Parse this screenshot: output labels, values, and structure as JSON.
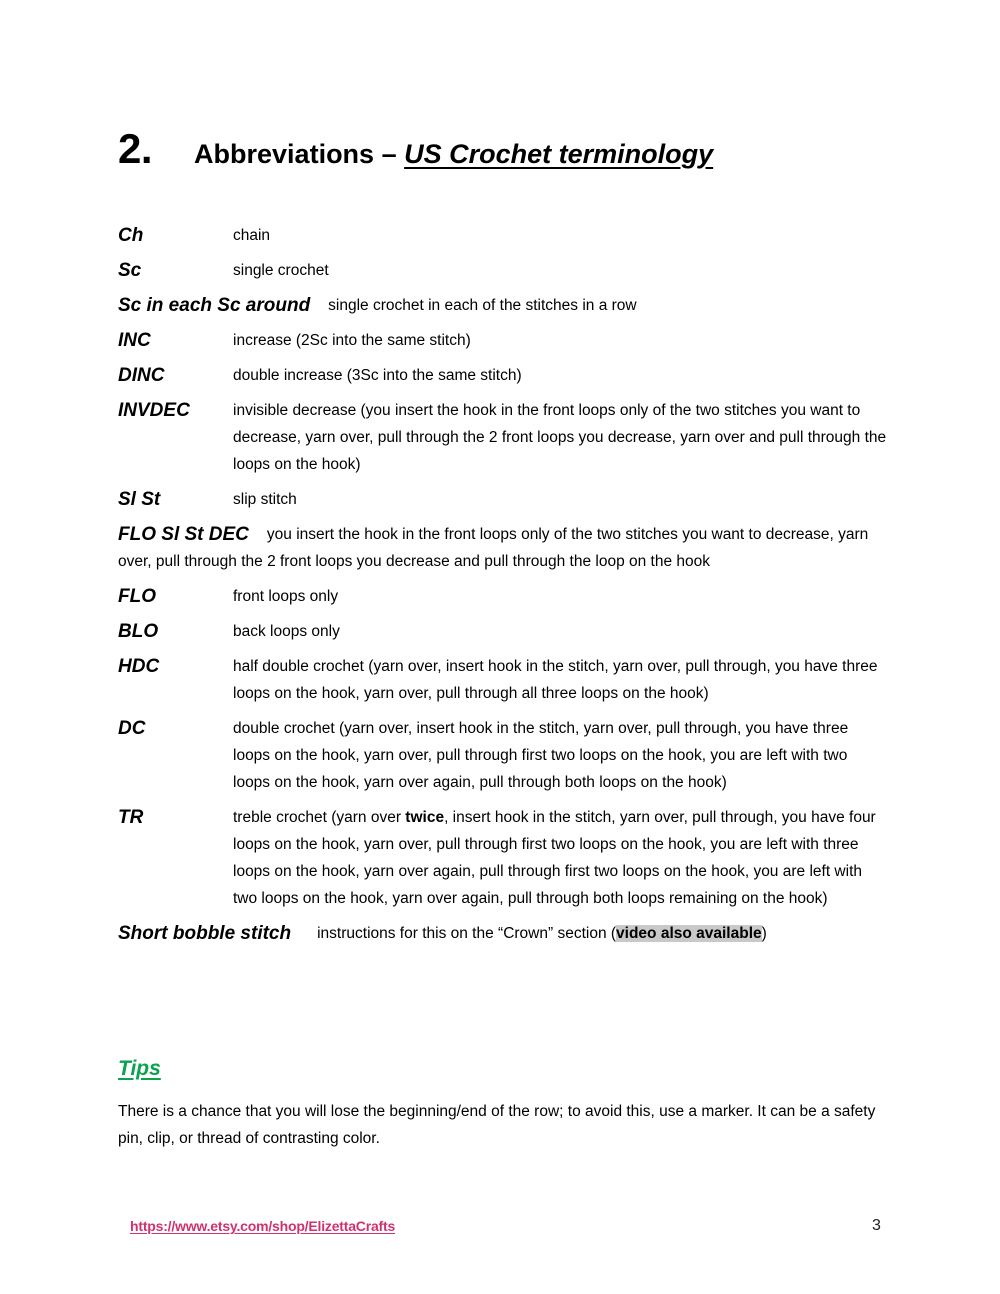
{
  "document": {
    "section_number": "2.",
    "section_title_plain": "Abbreviations – ",
    "section_title_emphasis": "US Crochet terminology"
  },
  "abbreviations": [
    {
      "term": "Ch",
      "definition": "chain",
      "layout": "inline"
    },
    {
      "term": "Sc",
      "definition": "single crochet",
      "layout": "inline"
    },
    {
      "term": "Sc in each Sc around",
      "definition": "single crochet in each of the stitches in a row",
      "layout": "wide"
    },
    {
      "term": "INC",
      "definition": "increase (2Sc into the same stitch)",
      "layout": "inline"
    },
    {
      "term": "DINC",
      "definition": "double increase (3Sc into the same stitch)",
      "layout": "inline"
    },
    {
      "term": "INVDEC",
      "definition": "invisible decrease (you insert the hook in the front loops only of the two stitches you want to decrease, yarn over, pull through the 2 front loops you decrease, yarn over and pull through the loops on the hook)",
      "layout": "block"
    },
    {
      "term": "Sl St",
      "definition": "slip stitch",
      "layout": "inline"
    },
    {
      "term": "FLO Sl St DEC",
      "definition": "you insert the hook in the front loops only of the two stitches you want to decrease, yarn over, pull through the 2 front loops you decrease and pull through the loop on the hook",
      "layout": "wide-block"
    },
    {
      "term": "FLO",
      "definition": "front loops only",
      "layout": "inline"
    },
    {
      "term": "BLO",
      "definition": "back loops only",
      "layout": "inline"
    },
    {
      "term": "HDC",
      "definition": "half double crochet (yarn over, insert hook in the stitch, yarn over, pull through, you have three loops on the hook, yarn over, pull through all three loops on the hook)",
      "layout": "block"
    },
    {
      "term": "DC",
      "definition": "double crochet (yarn over, insert hook in the stitch, yarn over, pull through, you have three loops on the hook, yarn over, pull through first two loops on the hook, you are left with two loops on the hook, yarn over again, pull through both loops on the hook)",
      "layout": "block"
    }
  ],
  "treble": {
    "term": "TR",
    "def_part1": "treble crochet (yarn over ",
    "def_bold": "twice",
    "def_part2": ", insert hook in the stitch, yarn over, pull through, you have four loops on the hook, yarn over, pull through first two loops on the hook, you are left with three loops on the hook, yarn over again, pull through first two loops on the hook, you are left with two loops on the hook, yarn over again, pull through both loops remaining on the hook)"
  },
  "bobble": {
    "term": "Short bobble stitch",
    "def_part1": "instructions for this on the “Crown” section (",
    "def_highlight": "video also available",
    "def_part2": ")"
  },
  "tips": {
    "heading": "Tips",
    "body": "There is a chance that you will lose the beginning/end of the row; to avoid this, use a marker. It can be a safety pin, clip, or thread of contrasting color."
  },
  "footer": {
    "shop_url": "https://www.etsy.com/shop/ElizettaCrafts",
    "page_number": "3"
  },
  "colors": {
    "tips_green": "#0aa24f",
    "link_pink": "#d0326f",
    "highlight_gray": "#c9c9c9"
  }
}
